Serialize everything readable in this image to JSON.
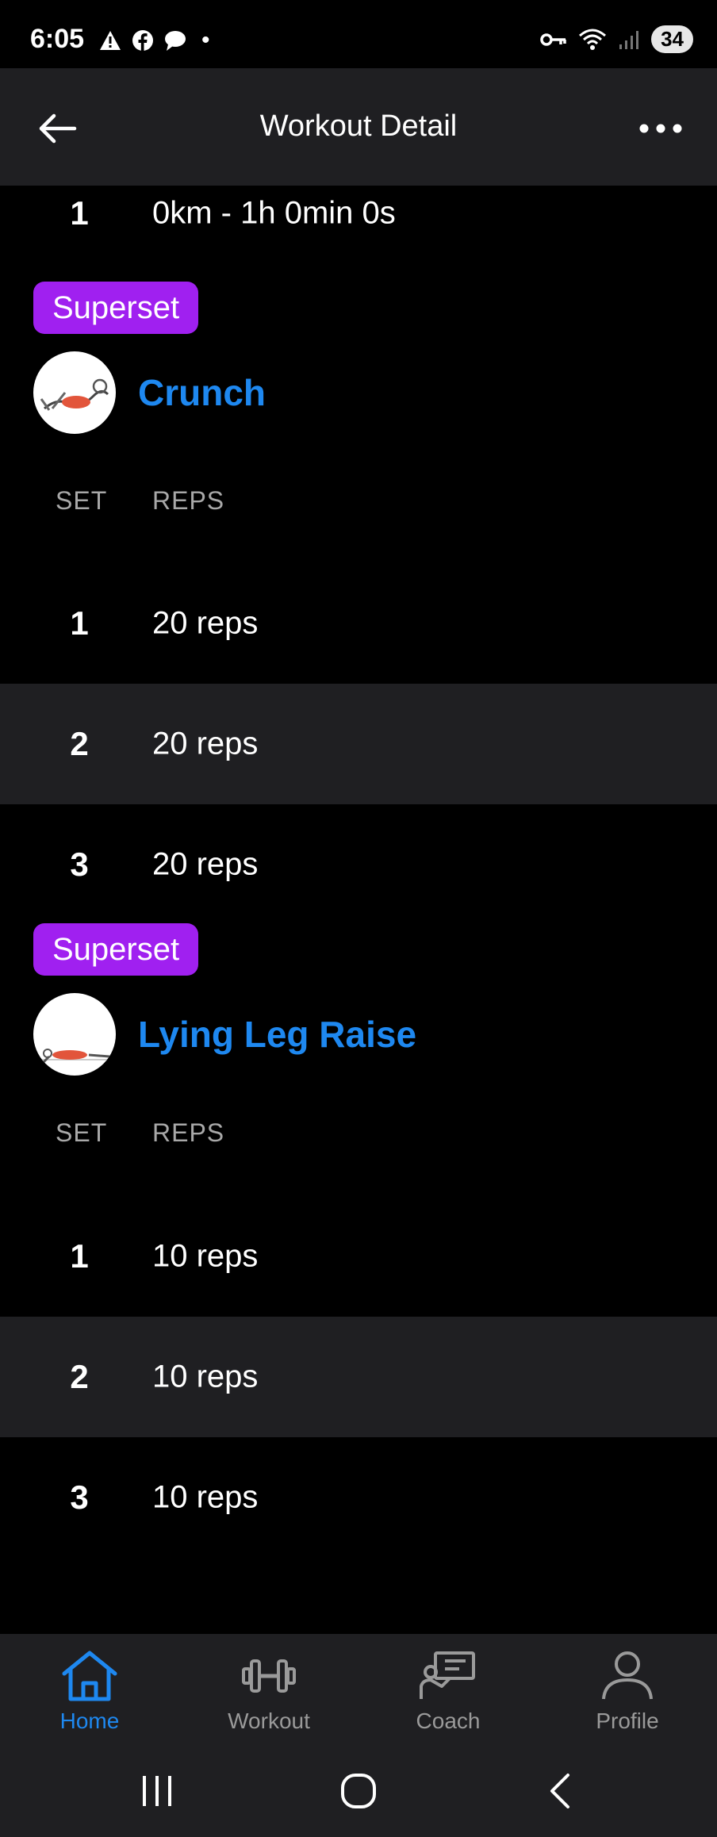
{
  "status_bar": {
    "time": "6:05",
    "battery": "34",
    "dot": "•"
  },
  "header": {
    "title": "Workout Detail"
  },
  "top_set": {
    "number": "1",
    "value": "0km - 1h 0min 0s"
  },
  "exercises": [
    {
      "badge": "Superset",
      "name": "Crunch",
      "col_set": "SET",
      "col_reps": "REPS",
      "sets": [
        {
          "number": "1",
          "value": "20 reps"
        },
        {
          "number": "2",
          "value": "20 reps"
        },
        {
          "number": "3",
          "value": "20 reps"
        }
      ]
    },
    {
      "badge": "Superset",
      "name": "Lying Leg Raise",
      "col_set": "SET",
      "col_reps": "REPS",
      "sets": [
        {
          "number": "1",
          "value": "10 reps"
        },
        {
          "number": "2",
          "value": "10 reps"
        },
        {
          "number": "3",
          "value": "10 reps"
        }
      ]
    }
  ],
  "bottom_nav": [
    {
      "label": "Home",
      "icon": "home-icon",
      "active": true
    },
    {
      "label": "Workout",
      "icon": "dumbbell-icon",
      "active": false
    },
    {
      "label": "Coach",
      "icon": "coach-icon",
      "active": false
    },
    {
      "label": "Profile",
      "icon": "profile-icon",
      "active": false
    }
  ],
  "colors": {
    "accent": "#1e88f0",
    "badge": "#a020f0",
    "surface": "#1f1f22",
    "background": "#000000"
  }
}
